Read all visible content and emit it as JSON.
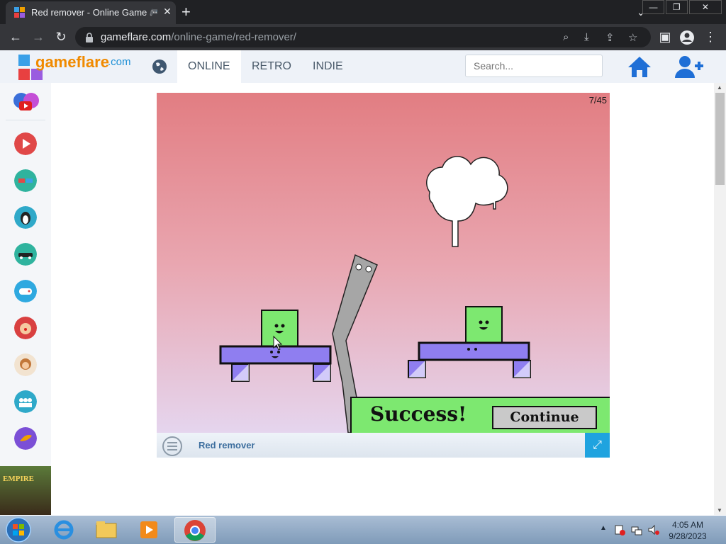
{
  "browser": {
    "tab_title": "Red remover - Online Game 🎮 | G",
    "url_domain": "gameflare.com",
    "url_path": "/online-game/red-remover/",
    "window_buttons": [
      "—",
      "❐",
      "✕"
    ]
  },
  "site": {
    "logo_text": "gameflare",
    "logo_domain": ".com",
    "nav": [
      "ONLINE",
      "RETRO",
      "INDIE"
    ],
    "search_placeholder": "Search..."
  },
  "sidebar": {
    "icons": [
      "youtube-icon",
      "play-icon",
      "3d-glasses-icon",
      "penguin-icon",
      "car-icon",
      "gamepad-icon",
      "clown-icon",
      "girl-icon",
      "crowd-icon",
      "animal-icon"
    ],
    "banner_text": "EMPIRE"
  },
  "game": {
    "level": "7/45",
    "success_text": "Success!",
    "continue_label": "Continue",
    "title": "Red remover"
  },
  "colors": {
    "block_green": "#7de870",
    "block_purple": "#8f7ef0",
    "accent_blue": "#1fa3df",
    "sky_top": "#e27d82",
    "sky_bottom": "#e5d5ee"
  },
  "taskbar": {
    "time": "4:05 AM",
    "date": "9/28/2023"
  }
}
